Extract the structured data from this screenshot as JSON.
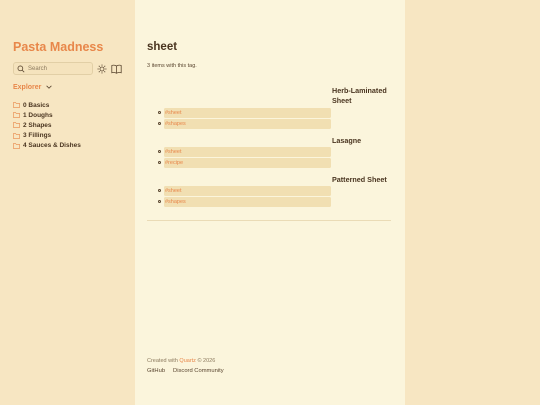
{
  "sidebar": {
    "title": "Pasta Madness",
    "search": {
      "placeholder": "Search"
    },
    "explorer": {
      "label": "Explorer"
    },
    "folders": [
      {
        "label": "0 Basics"
      },
      {
        "label": "1 Doughs"
      },
      {
        "label": "2 Shapes"
      },
      {
        "label": "3 Fillings"
      },
      {
        "label": "4 Sauces & Dishes"
      }
    ]
  },
  "main": {
    "title": "sheet",
    "count": "3 items with this tag.",
    "entries": [
      {
        "title": "Herb-Laminated Sheet",
        "tags": [
          "#sheet",
          "#shapes"
        ]
      },
      {
        "title": "Lasagne",
        "tags": [
          "#sheet",
          "#recipe"
        ]
      },
      {
        "title": "Patterned Sheet",
        "tags": [
          "#sheet",
          "#shapes"
        ]
      }
    ]
  },
  "footer": {
    "created_with": "Created with",
    "quartz": "Quartz",
    "year": "© 2026",
    "links": [
      "GitHub",
      "Discord Community"
    ]
  },
  "colors": {
    "accent": "#e8874a",
    "sidebar_bg": "#f7e6c2",
    "page_bg": "#fbf5dc",
    "tag_bg": "#f1dfb2"
  }
}
